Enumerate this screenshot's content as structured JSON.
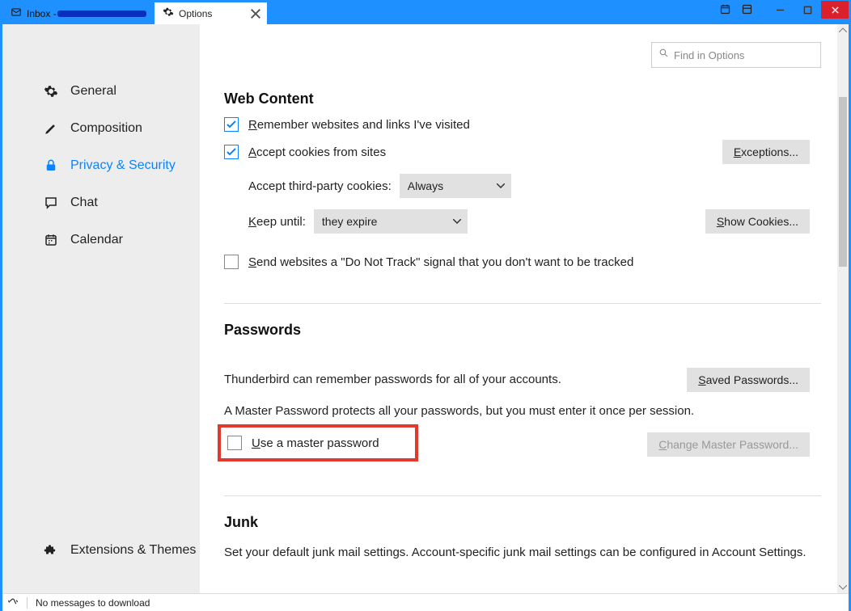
{
  "tabs": {
    "inbox_prefix": "Inbox - ",
    "options": "Options"
  },
  "search": {
    "placeholder": "Find in Options"
  },
  "sidebar": {
    "items": [
      {
        "label": "General"
      },
      {
        "label": "Composition"
      },
      {
        "label": "Privacy & Security"
      },
      {
        "label": "Chat"
      },
      {
        "label": "Calendar"
      }
    ],
    "extensions": "Extensions & Themes"
  },
  "webcontent": {
    "title": "Web Content",
    "remember": "emember websites and links I've visited",
    "accept_cookies": "ccept cookies from sites",
    "exceptions": "xceptions...",
    "third_party_label": "Accept third-party cookies:",
    "third_party_value": "Always",
    "keep_until_label": "eep until:",
    "keep_until_value": "they expire",
    "show_cookies": "how Cookies...",
    "dnt": "end websites a \"Do Not Track\" signal that you don't want to be tracked"
  },
  "passwords": {
    "title": "Passwords",
    "desc1": "Thunderbird can remember passwords for all of your accounts.",
    "saved": "aved Passwords...",
    "desc2": "A Master Password protects all your passwords, but you must enter it once per session.",
    "use_master": "se a master password",
    "change_master": "hange Master Password..."
  },
  "junk": {
    "title": "Junk",
    "desc": "Set your default junk mail settings. Account-specific junk mail settings can be configured in Account Settings."
  },
  "status": {
    "msg": "No messages to download"
  }
}
